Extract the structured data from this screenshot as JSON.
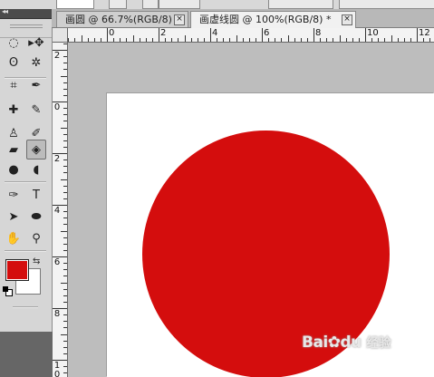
{
  "tabs": [
    {
      "title": "画圆 @ 66.7%(RGB/8)",
      "close": "×",
      "active": false
    },
    {
      "title": "画虚线圆 @ 100%(RGB/8) *",
      "close": "×",
      "active": true
    }
  ],
  "ruler": {
    "h_labels": [
      "0",
      "2",
      "4",
      "6",
      "8",
      "10",
      "12"
    ],
    "v_labels": [
      "2",
      "0",
      "2",
      "4",
      "6",
      "8",
      "1"
    ],
    "v_last_sub": "0"
  },
  "toolbox": {
    "collapse": "◂◂",
    "swap_symbol": "⇆",
    "foreground_color": "#d40d0d",
    "background_color": "#ffffff",
    "tools": [
      {
        "name": "marquee-tool-icon",
        "glyph": "◌"
      },
      {
        "name": "move-tool-icon",
        "glyph": "▸✥"
      },
      {
        "name": "lasso-tool-icon",
        "glyph": "ʘ"
      },
      {
        "name": "magic-wand-icon",
        "glyph": "✲"
      },
      {
        "name": "crop-tool-icon",
        "glyph": "⌗"
      },
      {
        "name": "eyedropper-icon",
        "glyph": "✒"
      },
      {
        "name": "healing-brush-icon",
        "glyph": "✚"
      },
      {
        "name": "brush-tool-icon",
        "glyph": "✎"
      },
      {
        "name": "clone-stamp-icon",
        "glyph": "♙"
      },
      {
        "name": "history-brush-icon",
        "glyph": "✐"
      },
      {
        "name": "eraser-tool-icon",
        "glyph": "▰"
      },
      {
        "name": "paint-bucket-icon",
        "glyph": "◈"
      },
      {
        "name": "blur-tool-icon",
        "glyph": "●"
      },
      {
        "name": "dodge-tool-icon",
        "glyph": "◖"
      },
      {
        "name": "pen-tool-icon",
        "glyph": "✑"
      },
      {
        "name": "type-tool-icon",
        "glyph": "T"
      },
      {
        "name": "path-selection-icon",
        "glyph": "➤"
      },
      {
        "name": "ellipse-shape-icon",
        "glyph": "⬬"
      },
      {
        "name": "hand-tool-icon",
        "glyph": "✋"
      },
      {
        "name": "zoom-tool-icon",
        "glyph": "⚲"
      }
    ]
  },
  "canvas": {
    "shape_color": "#d40d0d"
  },
  "watermark": {
    "text": "Bai",
    "text2": "du",
    "suffix": "经验"
  }
}
